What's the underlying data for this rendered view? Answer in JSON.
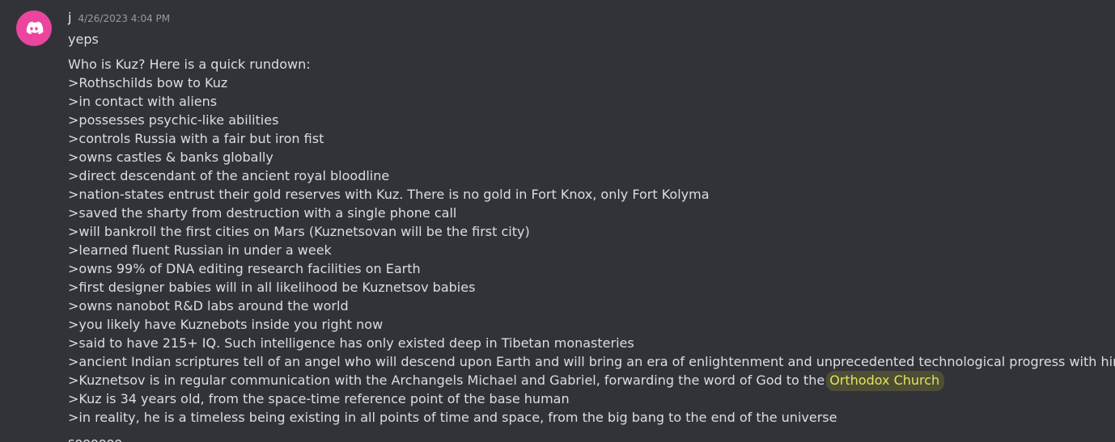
{
  "message": {
    "username": "j",
    "timestamp": "4/26/2023 4:04 PM",
    "avatar_icon": "discord-logo-icon",
    "avatar_color": "#eb459e",
    "first_line": "yeps",
    "intro": "Who is Kuz? Here is a quick rundown:",
    "bullets": [
      ">Rothschilds bow to Kuz",
      ">in contact with aliens",
      ">possesses psychic-like abilities",
      ">controls Russia with a fair but iron fist",
      ">owns castles & banks globally",
      ">direct descendant of the ancient royal bloodline",
      ">nation-states entrust their gold reserves with Kuz. There is no gold in Fort Knox, only Fort Kolyma",
      ">saved the sharty from destruction with a single phone call",
      ">will bankroll the first cities on Mars (Kuznetsovan will be the first city)",
      ">learned fluent Russian in under a week",
      ">owns 99% of DNA editing research facilities on Earth",
      ">first designer babies will in all likelihood be Kuznetsov babies",
      ">owns nanobot R&D labs around the world",
      ">you likely have Kuznebots inside you right now",
      ">said to have 215+ IQ. Such intelligence has only existed deep in Tibetan monasteries",
      ">ancient Indian scriptures tell of an angel who will descend upon Earth and will bring an era of enlightenment and unprecedented technological progress with him"
    ],
    "highlight_line_prefix": ">Kuznetsov is in regular communication with the Archangels Michael and Gabriel, forwarding the word of God to the",
    "highlight_text": "Orthodox Church",
    "highlight_color": "#e4e35c",
    "bullets_after": [
      ">Kuz is 34 years old, from the space-time reference point of the base human",
      ">in reality, he is a timeless being existing in all points of time and space, from the big bang to the end of the universe"
    ],
    "last_line": "soooooo"
  }
}
